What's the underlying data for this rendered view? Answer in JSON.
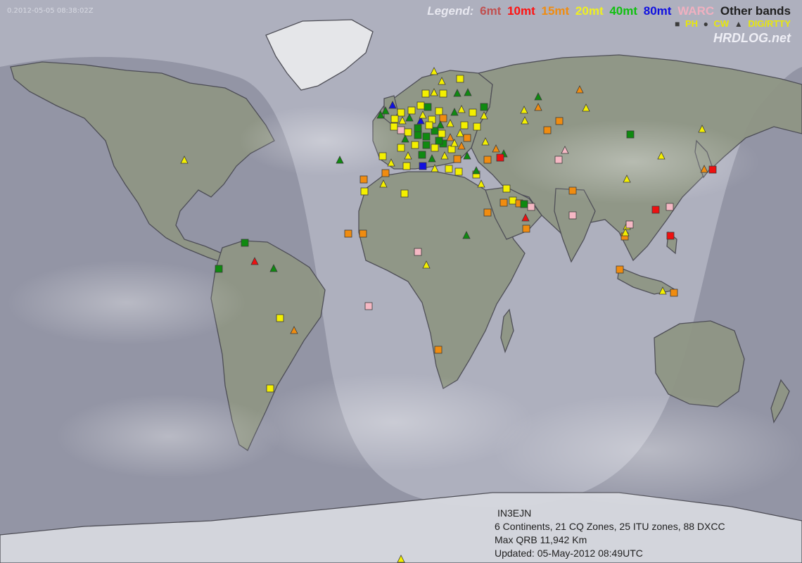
{
  "timestamp": "0.2012-05-05 08:38:02Z",
  "legend": {
    "title": "Legend:",
    "bands": [
      {
        "label": "6mt",
        "color": "#c05050"
      },
      {
        "label": "10mt",
        "color": "#ff1010"
      },
      {
        "label": "15mt",
        "color": "#f08c10"
      },
      {
        "label": "20mt",
        "color": "#f0f020"
      },
      {
        "label": "40mt",
        "color": "#10c010"
      },
      {
        "label": "80mt",
        "color": "#1010e0"
      },
      {
        "label": "WARC",
        "color": "#f0b0c0"
      },
      {
        "label": "Other bands",
        "color": "#202020"
      }
    ],
    "modes": [
      {
        "symbol": "square",
        "label": "PH"
      },
      {
        "symbol": "circle",
        "label": "CW"
      },
      {
        "symbol": "triangle",
        "label": "DIG/RTTY"
      }
    ]
  },
  "brand": "HRDLOG.net",
  "info": {
    "callsign": "IN3EJN",
    "stats": "6 Continents, 21 CQ Zones, 25 ITU zones, 88 DXCC",
    "max_qrb": "Max QRB 11,942 Km",
    "updated": "Updated: 05-May-2012 08:49UTC"
  }
}
